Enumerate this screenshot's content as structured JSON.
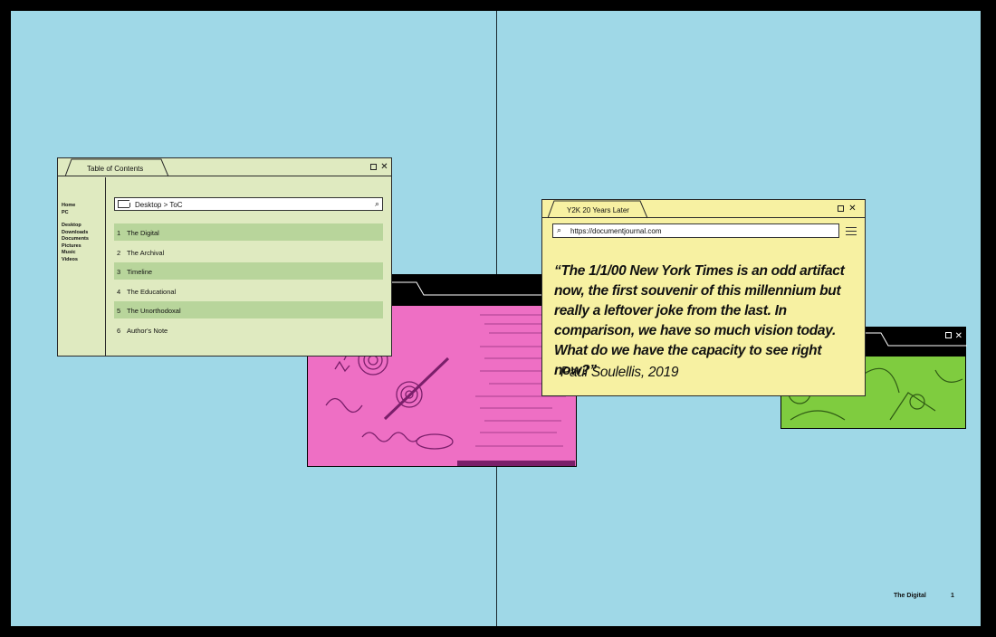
{
  "toc_window": {
    "tab_title": "Table of Contents",
    "sidebar": {
      "group1": [
        "Home",
        "PC"
      ],
      "group2": [
        "Desktop",
        "Downloads",
        "Documents",
        "Pictures",
        "Music",
        "Videos"
      ]
    },
    "path": "Desktop  >  ToC",
    "entries": [
      {
        "num": "1",
        "title": "The Digital"
      },
      {
        "num": "2",
        "title": "The Archival"
      },
      {
        "num": "3",
        "title": "Timeline"
      },
      {
        "num": "4",
        "title": "The Educational"
      },
      {
        "num": "5",
        "title": "The Unorthodoxal"
      },
      {
        "num": "6",
        "title": "Author's Note"
      }
    ]
  },
  "quote_window": {
    "tab_title": "Y2K 20 Years Later",
    "url": "https://documentjournal.com",
    "quote": "“The 1/1/00 New York Times is an odd artifact now, the first souvenir of this millennium but really a leftover joke from the last. In comparison, we have so much vision today. What do we have the capacity to see right now?”",
    "author": "Paul Soulellis, 2019"
  },
  "footer": {
    "section": "The Digital",
    "page": "1"
  },
  "colors": {
    "background": "#9fd8e7",
    "toc_window": "#dfeac0",
    "toc_highlight": "#b8d59b",
    "quote_window": "#f7f1a2",
    "pink_art": "#ee6fc4",
    "green_art": "#7fcc3f"
  }
}
